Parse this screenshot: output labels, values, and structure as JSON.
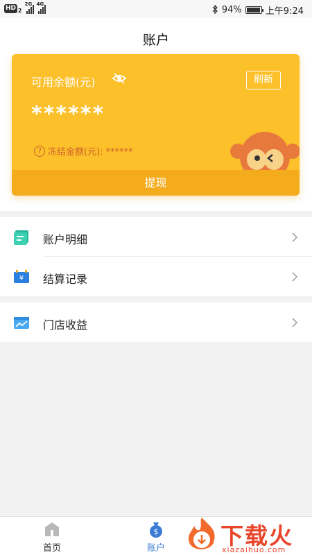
{
  "status_bar": {
    "hd": "HD",
    "sim": "2",
    "net1": "2G",
    "net2": "4G",
    "battery": "94%",
    "time": "上午9:24"
  },
  "header": {
    "title": "账户"
  },
  "card": {
    "balance_label": "可用余额(元)",
    "refresh_label": "刷新",
    "masked_balance": "******",
    "frozen_label": "冻结金额(元): ******",
    "withdraw_label": "提现",
    "colors": {
      "card": "#fcc02a",
      "withdraw": "#f4ac1d",
      "frozen_text": "#d0602b"
    }
  },
  "menu": {
    "group1": [
      {
        "label": "账户明细",
        "icon": "document-icon"
      },
      {
        "label": "结算记录",
        "icon": "yen-box-icon"
      }
    ],
    "group2": [
      {
        "label": "门店收益",
        "icon": "chart-icon"
      }
    ]
  },
  "tab_bar": {
    "tabs": [
      {
        "label": "首页",
        "icon": "home-icon",
        "active": false
      },
      {
        "label": "账户",
        "icon": "money-bag-icon",
        "active": true
      }
    ],
    "active_color": "#3a7bd5"
  },
  "watermark": {
    "text": "下载火",
    "sub": "xiazaihuo.com"
  }
}
